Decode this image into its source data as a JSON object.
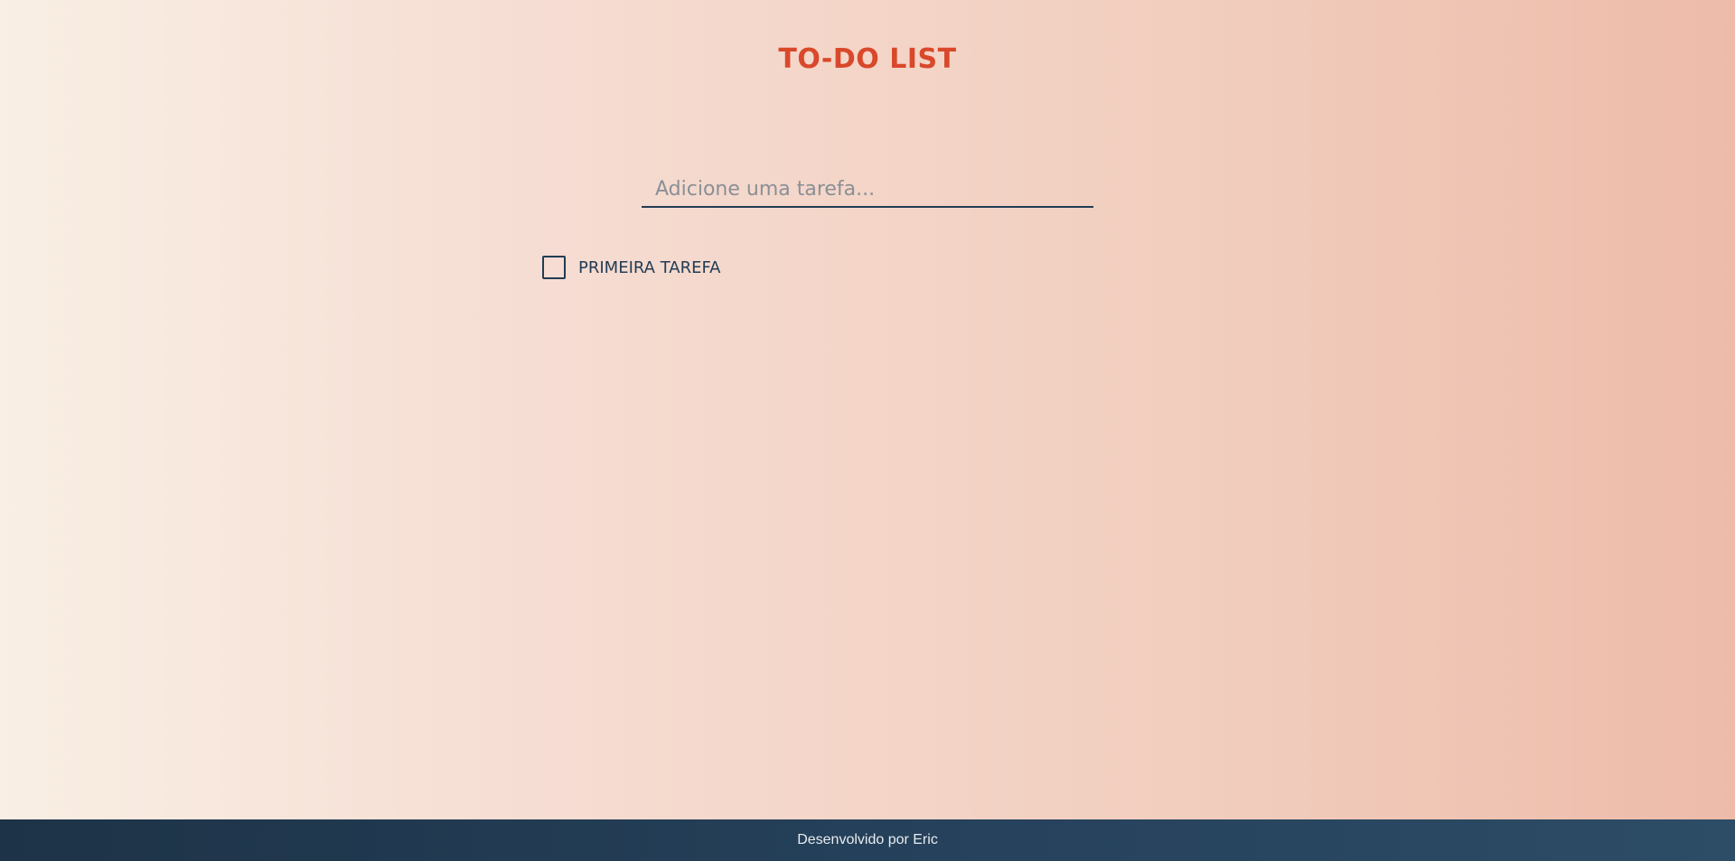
{
  "header": {
    "title": "TO-DO LIST"
  },
  "task_input": {
    "placeholder": "Adicione uma tarefa...",
    "value": ""
  },
  "tasks": [
    {
      "label": "PRIMEIRA TAREFA",
      "checked": false
    }
  ],
  "footer": {
    "text": "Desenvolvido por Eric"
  },
  "colors": {
    "title": "#d9482b",
    "text": "#223c55",
    "footer_background": "#25405a",
    "footer_text": "#e8ecf0",
    "background_start": "#f9efe4",
    "background_end": "#eebba9"
  }
}
